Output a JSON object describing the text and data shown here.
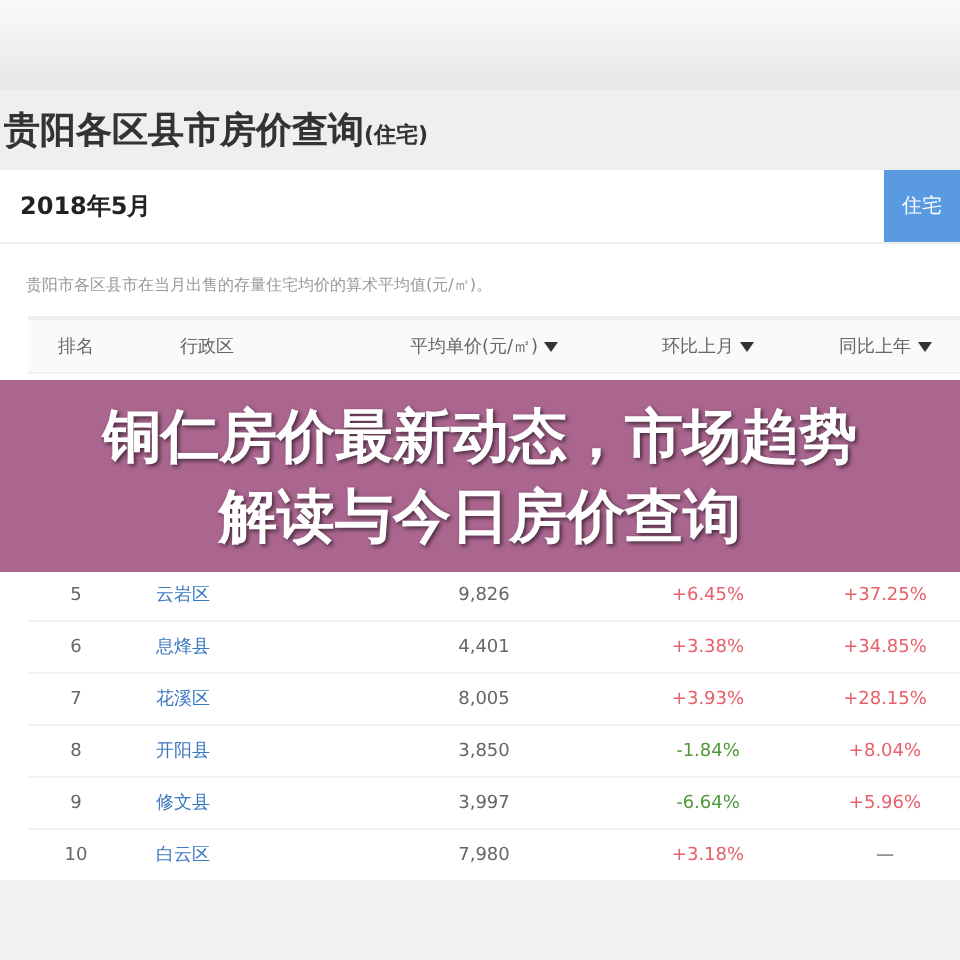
{
  "page_title": {
    "main": "贵阳各区县市房价查询",
    "suffix": "(住宅)"
  },
  "period": "2018年5月",
  "type_button": {
    "label": "住宅",
    "selected": true
  },
  "description": "贵阳市各区县市在当月出售的存量住宅均价的算术平均值(元/㎡)。",
  "table": {
    "columns": [
      {
        "label": "排名",
        "sortable": false
      },
      {
        "label": "行政区",
        "sortable": false
      },
      {
        "label": "平均单价(元/㎡)",
        "sortable": true
      },
      {
        "label": "环比上月",
        "sortable": true
      },
      {
        "label": "同比上年",
        "sortable": true
      }
    ],
    "rows": [
      {
        "rank": "5",
        "district": "云岩区",
        "price": "9,826",
        "month": {
          "text": "+6.45%",
          "color": "#e8606a"
        },
        "year": {
          "text": "+37.25%",
          "color": "#e8606a"
        }
      },
      {
        "rank": "6",
        "district": "息烽县",
        "price": "4,401",
        "month": {
          "text": "+3.38%",
          "color": "#e8606a"
        },
        "year": {
          "text": "+34.85%",
          "color": "#e8606a"
        }
      },
      {
        "rank": "7",
        "district": "花溪区",
        "price": "8,005",
        "month": {
          "text": "+3.93%",
          "color": "#e8606a"
        },
        "year": {
          "text": "+28.15%",
          "color": "#e8606a"
        }
      },
      {
        "rank": "8",
        "district": "开阳县",
        "price": "3,850",
        "month": {
          "text": "-1.84%",
          "color": "#4f9a3a"
        },
        "year": {
          "text": "+8.04%",
          "color": "#e8606a"
        }
      },
      {
        "rank": "9",
        "district": "修文县",
        "price": "3,997",
        "month": {
          "text": "-6.64%",
          "color": "#4f9a3a"
        },
        "year": {
          "text": "+5.96%",
          "color": "#e8606a"
        }
      },
      {
        "rank": "10",
        "district": "白云区",
        "price": "7,980",
        "month": {
          "text": "+3.18%",
          "color": "#e8606a"
        },
        "year": {
          "text": "—"
        }
      }
    ]
  },
  "banner": {
    "lines": [
      "铜仁房价最新动态，市场趋势",
      "解读与今日房价查询"
    ]
  }
}
